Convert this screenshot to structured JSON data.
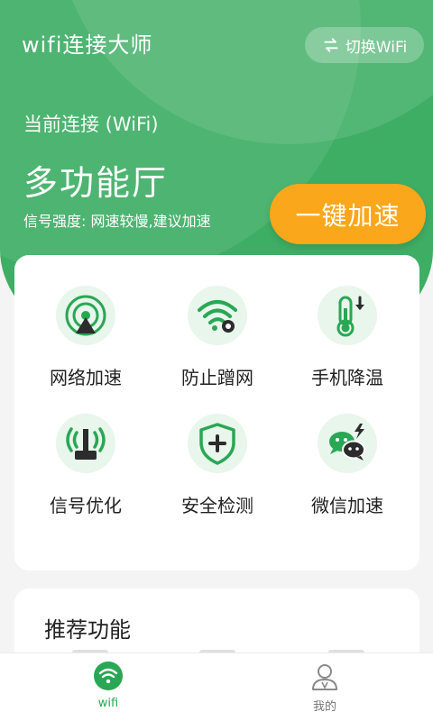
{
  "header": {
    "app_title": "wifi连接大师",
    "switch_label": "切换WiFi"
  },
  "connection": {
    "label": "当前连接 (WiFi)",
    "ssid": "多功能厅",
    "signal_text": "信号强度: 网速较慢,建议加速",
    "boost_label": "一键加速"
  },
  "features": [
    {
      "label": "网络加速",
      "icon": "network-boost-icon"
    },
    {
      "label": "防止蹭网",
      "icon": "wifi-lock-icon"
    },
    {
      "label": "手机降温",
      "icon": "thermometer-icon"
    },
    {
      "label": "信号优化",
      "icon": "signal-tower-icon"
    },
    {
      "label": "安全检测",
      "icon": "shield-plus-icon"
    },
    {
      "label": "微信加速",
      "icon": "wechat-icon"
    }
  ],
  "recommend": {
    "title": "推荐功能"
  },
  "tabbar": {
    "tabs": [
      {
        "label": "wifi",
        "active": true
      },
      {
        "label": "我的",
        "active": false
      }
    ]
  },
  "colors": {
    "primary_green": "#3fae65",
    "icon_green": "#2aa754",
    "accent_orange": "#fba71b"
  }
}
